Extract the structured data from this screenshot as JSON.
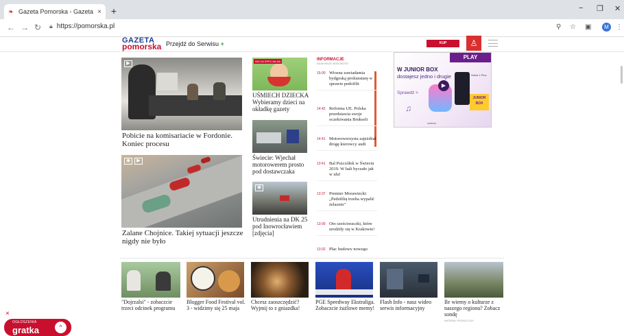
{
  "browser": {
    "tab_title": "Gazeta Pomorska - Gazeta Pomo",
    "tab_close": "×",
    "new_tab": "+",
    "url": "https://pomorska.pl",
    "profile_initial": "M",
    "win_minimize": "−",
    "win_maximize": "❐",
    "win_close": "✕"
  },
  "site": {
    "logo_line1": "GAZETA",
    "logo_line2": "pomorska",
    "przejdz": "Przejdź do Serwisu",
    "przejdz_plus": "+",
    "kup_button": "KUP PRENUMERATĘ"
  },
  "featured": [
    {
      "title": "Pobicie na komisariacie w Fordonie. Koniec procesu"
    },
    {
      "title": "Zalane Chojnice. Takiej sytuacji jeszcze nigdy nie było"
    }
  ],
  "middle": [
    {
      "badge": "AKCJA SPECJALNA",
      "title": "UŚMIECH DZIECKA Wybieramy dzieci na okładkę gazety"
    },
    {
      "title": "Świecie: Wjechał motorowerem prosto pod dostawczaka"
    },
    {
      "title": "Utrudnienia na DK 25 pod Inowrocławiem [zdjęcia]"
    }
  ],
  "informacje": {
    "title": "INFORMACJE",
    "subtitle": "NAJNOWSZE WIADOMOŚCI",
    "items": [
      {
        "time": "15:00",
        "text": "Wiosna zawiadamia bydgoską prokuraturę w sprawie pedofilii"
      },
      {
        "time": "14:42",
        "text": "Reforma UE. Polska przedstawia swoje oczekiwania Brukseli"
      },
      {
        "time": "14:41",
        "text": "Motorowerzysta zajeżdżał drogę kierowcy audi"
      },
      {
        "time": "13:41",
        "text": "Bal Pszczółek w Świeciu 2019. W hali byczało jak w ulu!"
      },
      {
        "time": "13:37",
        "text": "Premier Morawiecki: „Pedofilię trzeba wypalić żelazem”"
      },
      {
        "time": "13:09",
        "text": "Oto sześcioraczki, które urodziły się w Krakowie!"
      },
      {
        "time": "13:02",
        "text": "Plac budowy nowego"
      }
    ]
  },
  "ad": {
    "brand_top": "PLAY",
    "headline": "W JUNIOR BOX",
    "text": "dostajesz jedno i drugie",
    "cta": "Sprawdź >",
    "nokia": "Nokia 1 Plus",
    "box": "JUNIOR BOX",
    "maker": "mekton"
  },
  "bottom": [
    {
      "title": "\"Dojrzalsi\" - zobaczcie trzeci odcinek programu",
      "sub": ""
    },
    {
      "title": "Blogger Food Festival vol. 3 - widzimy się 25 maja",
      "sub": ""
    },
    {
      "title": "Chcesz zaoszczędzić? Wyjmij to z gniazdka!",
      "sub": ""
    },
    {
      "title": "PGE Speedway Ekstraliga. Zobaczcie żużlowe memy!",
      "sub": ""
    },
    {
      "title": "Flash Info - nasz wideo serwis informacyjny",
      "sub": ""
    },
    {
      "title": "Ile wiemy o kulturze z naszego regionu? Zobacz sondę",
      "sub": "MATERIAŁ PROMOCYJNY"
    }
  ],
  "ogloszenia": {
    "close": "×",
    "label": "OGŁOSZENIA",
    "brand": "gratka",
    "button": "^"
  }
}
